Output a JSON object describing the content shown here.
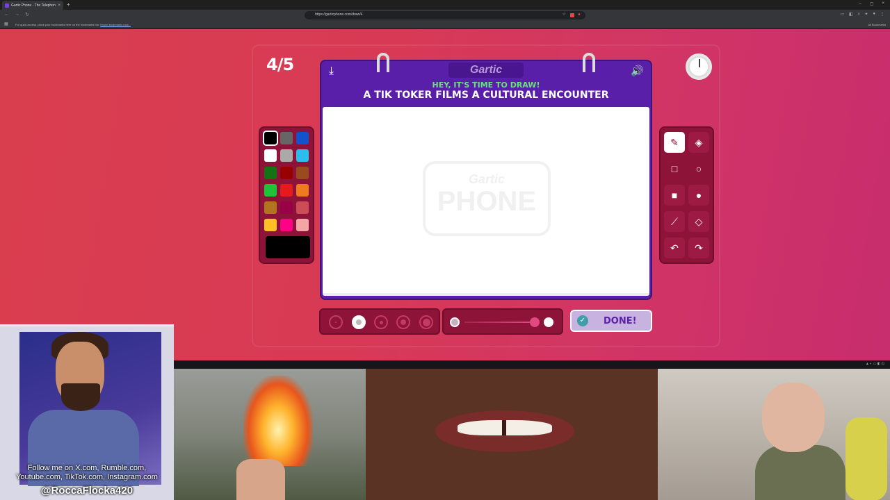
{
  "browser": {
    "tab_title": "Gartic Phone - The Telephone G...",
    "tab_close": "×",
    "new_tab": "+",
    "window_controls": [
      "–",
      "▢",
      "×"
    ],
    "url": "https://garticphone.com/draw/4",
    "bookmark_msg": "For quick access, place your bookmarks here on the bookmarks bar.",
    "import_link": "Import bookmarks now...",
    "all_bookmarks": "All Bookmarks"
  },
  "game": {
    "round": "4/5",
    "logo": "Gartic",
    "prompt_sub": "HEY, IT'S TIME TO DRAW!",
    "prompt": "A TIK TOKER FILMS A CULTURAL ENCOUNTER",
    "watermark_top": "Gartic",
    "watermark_bottom": "PHONE",
    "done_label": "DONE!",
    "current_color": "#000000",
    "brush_size_selected": 2,
    "opacity": 1.0
  },
  "palette": [
    [
      "#000000",
      "#666666",
      "#1452cc"
    ],
    [
      "#ffffff",
      "#aaaaaa",
      "#2bbdee"
    ],
    [
      "#147315",
      "#990000",
      "#994a1e"
    ],
    [
      "#1ec337",
      "#e61a1a",
      "#ef7a21"
    ],
    [
      "#b3741f",
      "#990047",
      "#cc4d57"
    ],
    [
      "#ffc026",
      "#ff0087",
      "#f4a6a6"
    ]
  ],
  "tools": [
    "pencil",
    "eraser",
    "rect-outline",
    "circle-outline",
    "rect-filled",
    "circle-filled",
    "line",
    "fill",
    "undo",
    "redo"
  ],
  "overlay": {
    "caption_line1": "Follow me on X.com, Rumble.com,",
    "caption_line2": "Youtube.com, TikTok.com, Instagram.com",
    "handle": "@RoccaFlocka420"
  }
}
